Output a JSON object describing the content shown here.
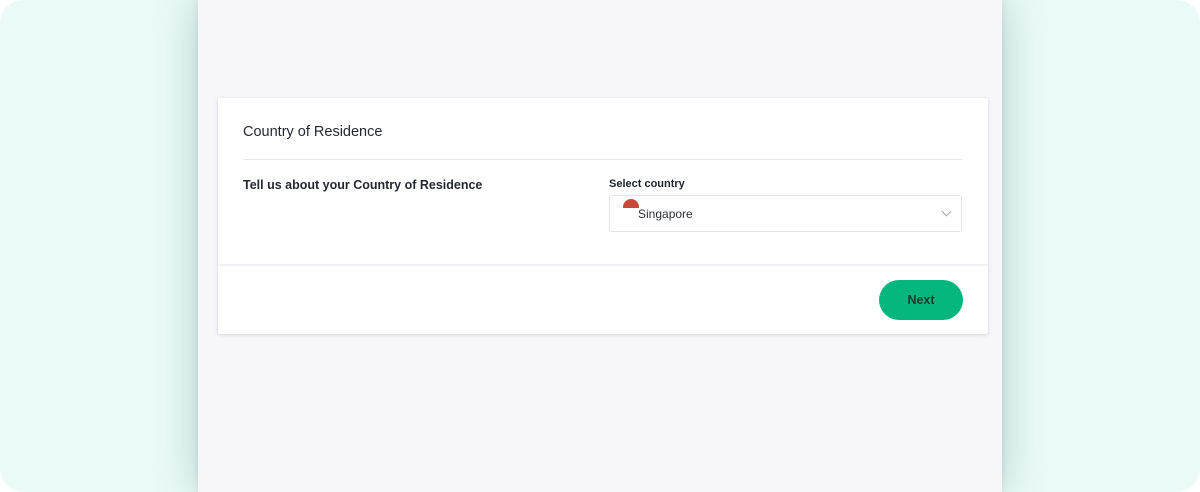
{
  "card": {
    "title": "Country of Residence",
    "section_label": "Tell us about your Country of Residence"
  },
  "country_select": {
    "label": "Select country",
    "value": "Singapore",
    "flag_icon": "singapore-flag-icon",
    "chevron_icon": "chevron-down-icon"
  },
  "footer": {
    "next_label": "Next"
  },
  "colors": {
    "outer_background": "#eafaf8",
    "page_background": "#f7f7fb",
    "card_background": "#ffffff",
    "primary_button": "#06b77d",
    "flag_red": "#c8493a"
  }
}
